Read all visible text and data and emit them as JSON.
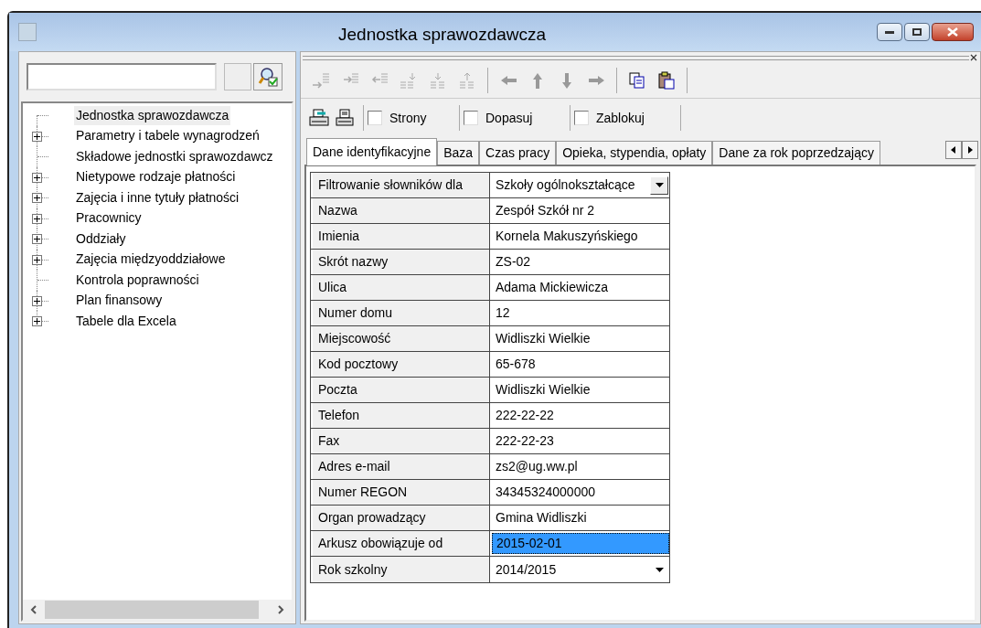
{
  "window": {
    "title": "Jednostka sprawozdawcza"
  },
  "tree": [
    {
      "label": "Jednostka sprawozdawcza",
      "expandable": false,
      "selected": true
    },
    {
      "label": "Parametry i tabele wynagrodzeń",
      "expandable": true,
      "selected": false
    },
    {
      "label": "Składowe jednostki sprawozdawcz",
      "expandable": false,
      "selected": false
    },
    {
      "label": "Nietypowe rodzaje płatności",
      "expandable": true,
      "selected": false
    },
    {
      "label": "Zajęcia i inne tytuły płatności",
      "expandable": true,
      "selected": false
    },
    {
      "label": "Pracownicy",
      "expandable": true,
      "selected": false
    },
    {
      "label": "Oddziały",
      "expandable": true,
      "selected": false
    },
    {
      "label": "Zajęcia międzyoddziałowe",
      "expandable": true,
      "selected": false
    },
    {
      "label": "Kontrola poprawności",
      "expandable": false,
      "selected": false
    },
    {
      "label": "Plan finansowy",
      "expandable": true,
      "selected": false
    },
    {
      "label": "Tabele dla Excela",
      "expandable": true,
      "selected": false
    }
  ],
  "options": [
    {
      "label": "Strony",
      "checked": false
    },
    {
      "label": "Dopasuj",
      "checked": false
    },
    {
      "label": "Zablokuj",
      "checked": false
    }
  ],
  "tabs": [
    {
      "label": "Dane identyfikacyjne",
      "selected": true
    },
    {
      "label": "Baza",
      "selected": false
    },
    {
      "label": "Czas pracy",
      "selected": false
    },
    {
      "label": "Opieka, stypendia, opłaty",
      "selected": false
    },
    {
      "label": "Dane za rok poprzedzający",
      "selected": false
    }
  ],
  "fields": [
    {
      "label": "Filtrowanie słowników dla",
      "value": "Szkoły ogólnokształcące",
      "kind": "combo",
      "selected": false
    },
    {
      "label": "Nazwa",
      "value": "Zespół Szkół nr 2",
      "kind": "text",
      "selected": false
    },
    {
      "label": "Imienia",
      "value": "Kornela Makuszyńskiego",
      "kind": "text",
      "selected": false
    },
    {
      "label": "Skrót nazwy",
      "value": "ZS-02",
      "kind": "text",
      "selected": false
    },
    {
      "label": "Ulica",
      "value": "Adama Mickiewicza",
      "kind": "text",
      "selected": false
    },
    {
      "label": "Numer domu",
      "value": "12",
      "kind": "text",
      "selected": false
    },
    {
      "label": "Miejscowość",
      "value": "Widliszki Wielkie",
      "kind": "text",
      "selected": false
    },
    {
      "label": "Kod pocztowy",
      "value": "65-678",
      "kind": "text",
      "selected": false
    },
    {
      "label": "Poczta",
      "value": "Widliszki Wielkie",
      "kind": "text",
      "selected": false
    },
    {
      "label": "Telefon",
      "value": "222-22-22",
      "kind": "text",
      "selected": false
    },
    {
      "label": "Fax",
      "value": "222-22-23",
      "kind": "text",
      "selected": false
    },
    {
      "label": "Adres e-mail",
      "value": "zs2@ug.ww.pl",
      "kind": "text",
      "selected": false
    },
    {
      "label": "Numer REGON",
      "value": "34345324000000",
      "kind": "text",
      "selected": false
    },
    {
      "label": "Organ prowadzący",
      "value": "Gmina Widliszki",
      "kind": "text",
      "selected": false
    },
    {
      "label": "Arkusz obowiązuje od",
      "value": "2015-02-01",
      "kind": "text",
      "selected": true
    },
    {
      "label": "Rok szkolny",
      "value": "2014/2015",
      "kind": "dropdown",
      "selected": false
    }
  ]
}
